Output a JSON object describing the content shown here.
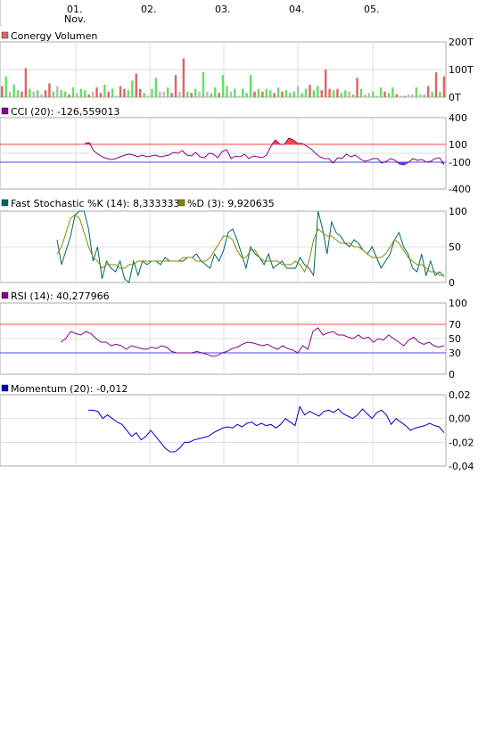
{
  "x_axis": {
    "dates": [
      "01.",
      "02.",
      "03.",
      "04.",
      "05."
    ],
    "month_label": "Nov."
  },
  "colors": {
    "up": "#66dd66",
    "down": "#dd6666",
    "neutral": "#bbbbbb",
    "cci": "#880088",
    "cci_fill_pos": "#ff4444",
    "cci_fill_neg": "#4444ff",
    "k": "#006666",
    "d": "#888800",
    "rsi": "#880088",
    "momentum": "#0000cc",
    "upper_line": "#ff4444",
    "lower_line": "#4444ff",
    "grid": "#dddddd"
  },
  "chart_data": [
    {
      "type": "bar",
      "title": "Conergy Volumen",
      "ylim": [
        0,
        200
      ],
      "yticks": [
        "200T",
        "100T",
        "0T"
      ],
      "values": [
        40,
        75,
        20,
        45,
        25,
        20,
        105,
        30,
        20,
        25,
        10,
        25,
        50,
        20,
        40,
        25,
        20,
        10,
        35,
        15,
        30,
        25,
        10,
        20,
        35,
        15,
        45,
        20,
        30,
        5,
        40,
        30,
        25,
        60,
        85,
        30,
        15,
        5,
        30,
        70,
        20,
        20,
        35,
        15,
        80,
        20,
        140,
        20,
        15,
        30,
        20,
        90,
        20,
        15,
        35,
        15,
        80,
        40,
        20,
        30,
        5,
        30,
        15,
        80,
        20,
        30,
        20,
        30,
        25,
        15,
        35,
        20,
        25,
        15,
        20,
        40,
        15,
        30,
        45,
        25,
        40,
        25,
        100,
        30,
        25,
        30,
        15,
        25,
        20,
        10,
        70,
        30,
        10,
        15,
        20,
        5,
        35,
        20,
        15,
        35,
        10,
        5,
        5,
        10,
        10,
        35,
        10,
        10,
        40,
        20,
        90,
        20,
        75
      ],
      "colors": [
        "d",
        "u",
        "n",
        "u",
        "u",
        "d",
        "d",
        "u",
        "n",
        "u",
        "n",
        "d",
        "d",
        "u",
        "n",
        "u",
        "u",
        "d",
        "u",
        "n",
        "u",
        "u",
        "d",
        "n",
        "d",
        "d",
        "u",
        "d",
        "u",
        "n",
        "d",
        "d",
        "u",
        "u",
        "d",
        "d",
        "u",
        "n",
        "u",
        "u",
        "n",
        "n",
        "u",
        "d",
        "d",
        "n",
        "d",
        "u",
        "d",
        "u",
        "n",
        "u",
        "n",
        "u",
        "u",
        "d",
        "u",
        "u",
        "n",
        "u",
        "n",
        "u",
        "u",
        "u",
        "d",
        "u",
        "d",
        "u",
        "u",
        "d",
        "u",
        "d",
        "u",
        "u",
        "u",
        "n",
        "u",
        "u",
        "d",
        "u",
        "u",
        "d",
        "d",
        "d",
        "u",
        "d",
        "u",
        "u",
        "n",
        "u",
        "d",
        "u",
        "n",
        "n",
        "u",
        "n",
        "u",
        "d",
        "u",
        "u",
        "d",
        "n",
        "u",
        "n",
        "n",
        "u",
        "n",
        "u",
        "d",
        "u",
        "d",
        "u",
        "d"
      ]
    },
    {
      "type": "line",
      "title": "CCI (20): -126,559013",
      "ylim": [
        -400,
        400
      ],
      "yticks": [
        "400",
        "100",
        "-100",
        "-400"
      ],
      "reference_lines": [
        100,
        -100
      ],
      "x": [
        19,
        21,
        22,
        25,
        28,
        31,
        35,
        40,
        46,
        52,
        56,
        60,
        64,
        68,
        71,
        74,
        77,
        80,
        83,
        86,
        90,
        94,
        97,
        101,
        104,
        108,
        112,
        115,
        118,
        122,
        126,
        130,
        133,
        136,
        138,
        140,
        143,
        147,
        150,
        154,
        158,
        161,
        163,
        166,
        170,
        174,
        177,
        180,
        184,
        187,
        190,
        193,
        197,
        200,
        204,
        209,
        213,
        217,
        221,
        225,
        229,
        233
      ],
      "y": [
        110,
        120,
        30,
        -10,
        -40,
        -60,
        -70,
        -60,
        -40,
        -20,
        -10,
        -20,
        -40,
        -20,
        -40,
        -30,
        -20,
        -40,
        -30,
        -20,
        10,
        0,
        30,
        -20,
        -30,
        10,
        -40,
        -50,
        0,
        -10,
        -50,
        20,
        40,
        -60,
        -30,
        -40,
        -10,
        -60,
        -30,
        -40,
        -50,
        -20,
        80,
        150,
        100,
        100,
        170,
        150,
        110,
        110,
        80,
        50,
        0,
        -40,
        -60,
        -60,
        -110,
        -50,
        -60,
        -10,
        -40,
        -20
      ],
      "extra_y": [
        -60,
        -90,
        -80,
        -60,
        -60,
        -110,
        -90,
        -60,
        -80,
        -120,
        -130,
        -100,
        -60,
        -80,
        -70,
        -100,
        -90,
        -60,
        -50,
        -126.56
      ]
    },
    {
      "type": "line",
      "title_k": "Fast Stochastic %K (14): 8,333333",
      "title_d": "%D (3): 9,920635",
      "ylim": [
        0,
        100
      ],
      "yticks": [
        "100",
        "50",
        "0"
      ],
      "series": [
        {
          "name": "Fast Stochastic %K (14): 8,333333",
          "values": [
            60,
            25,
            45,
            65,
            95,
            100,
            100,
            75,
            30,
            50,
            5,
            30,
            20,
            15,
            30,
            5,
            0,
            30,
            10,
            30,
            25,
            30,
            30,
            25,
            35,
            30,
            30,
            30,
            30,
            35,
            35,
            40,
            30,
            25,
            20,
            40,
            30,
            45,
            70,
            75,
            60,
            40,
            20,
            50,
            40,
            35,
            25,
            40,
            20,
            25,
            30,
            20,
            20,
            20,
            35,
            25,
            20,
            10,
            100,
            75,
            40,
            85,
            70,
            65,
            55,
            50,
            60,
            55,
            45,
            40,
            50,
            35,
            20,
            30,
            40,
            60,
            70,
            50,
            40,
            20,
            15,
            40,
            10,
            30,
            10,
            15,
            8.33
          ]
        },
        {
          "name": "%D (3): 9,920635",
          "values": [
            40,
            50,
            70,
            90,
            95,
            90,
            70,
            50,
            35,
            30,
            20,
            25,
            25,
            25,
            20,
            20,
            25,
            25,
            30,
            30,
            30,
            30,
            30,
            30,
            30,
            30,
            30,
            30,
            35,
            35,
            35,
            30,
            30,
            30,
            35,
            45,
            55,
            65,
            65,
            60,
            45,
            35,
            35,
            45,
            45,
            35,
            30,
            30,
            30,
            30,
            25,
            25,
            25,
            30,
            25,
            15,
            30,
            60,
            75,
            70,
            65,
            65,
            60,
            55,
            55,
            55,
            50,
            50,
            45,
            40,
            35,
            35,
            35,
            40,
            50,
            60,
            55,
            45,
            35,
            30,
            25,
            25,
            20,
            15,
            15,
            10,
            9.92
          ]
        }
      ]
    },
    {
      "type": "line",
      "title": "RSI (14): 40,277966",
      "ylim": [
        0,
        100
      ],
      "yticks": [
        "100",
        "70",
        "50",
        "30",
        "0"
      ],
      "reference_lines": [
        70,
        30
      ],
      "values": [
        45,
        50,
        60,
        57,
        55,
        60,
        57,
        50,
        45,
        45,
        40,
        42,
        40,
        35,
        40,
        38,
        36,
        35,
        38,
        36,
        40,
        38,
        32,
        30,
        30,
        30,
        30,
        32,
        30,
        28,
        25,
        26,
        30,
        32,
        36,
        38,
        42,
        45,
        44,
        42,
        40,
        42,
        38,
        35,
        40,
        36,
        34,
        30,
        40,
        35,
        60,
        65,
        55,
        58,
        60,
        55,
        55,
        52,
        50,
        55,
        50,
        52,
        45,
        50,
        48,
        55,
        50,
        45,
        40,
        48,
        52,
        45,
        42,
        45,
        40,
        38,
        40.28
      ]
    },
    {
      "type": "line",
      "title": "Momentum (20): -0,012",
      "ylim": [
        -0.04,
        0.02
      ],
      "yticks": [
        "0,02",
        "0,00",
        "-0,02",
        "-0,04"
      ],
      "values": [
        0.007,
        0.007,
        0.006,
        0.0,
        0.003,
        0.0,
        -0.003,
        -0.005,
        -0.01,
        -0.015,
        -0.012,
        -0.018,
        -0.015,
        -0.01,
        -0.015,
        -0.02,
        -0.025,
        -0.028,
        -0.028,
        -0.025,
        -0.02,
        -0.02,
        -0.018,
        -0.017,
        -0.016,
        -0.015,
        -0.012,
        -0.01,
        -0.008,
        -0.007,
        -0.008,
        -0.005,
        -0.007,
        -0.004,
        -0.003,
        -0.006,
        -0.004,
        -0.006,
        -0.005,
        -0.008,
        -0.005,
        0.0,
        -0.003,
        -0.006,
        0.01,
        0.003,
        0.006,
        0.004,
        0.002,
        0.006,
        0.007,
        0.005,
        0.008,
        0.004,
        0.002,
        0.0,
        0.003,
        0.008,
        0.004,
        0.0,
        0.005,
        0.007,
        0.003,
        -0.005,
        0.0,
        -0.003,
        -0.006,
        -0.01,
        -0.008,
        -0.007,
        -0.006,
        -0.004,
        -0.006,
        -0.007,
        -0.012
      ]
    }
  ]
}
